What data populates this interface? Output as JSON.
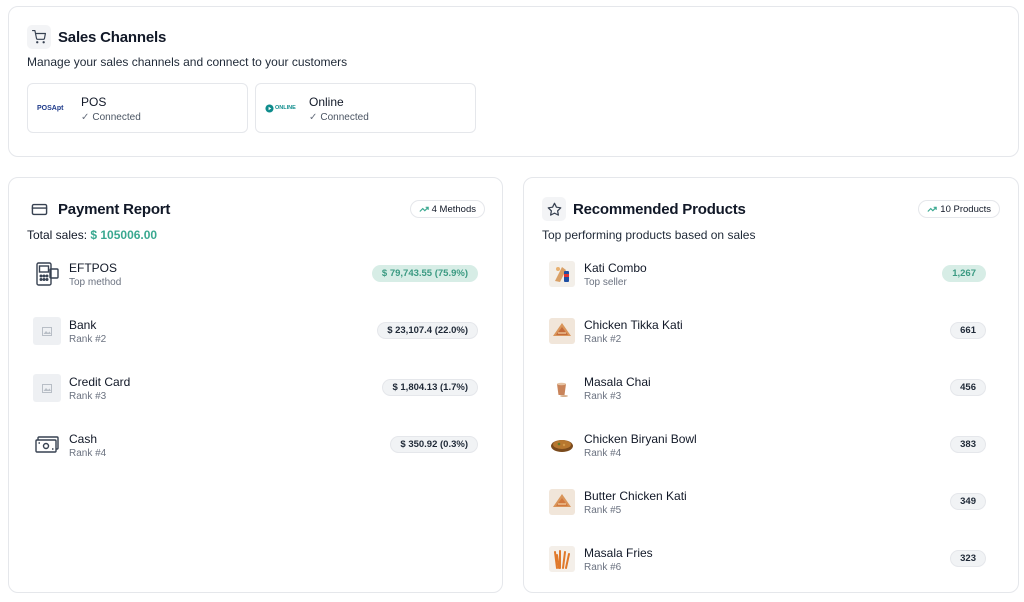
{
  "sales_channels": {
    "title": "Sales Channels",
    "subtitle": "Manage your sales channels and connect to your customers",
    "channels": [
      {
        "name": "POS",
        "status": "Connected",
        "logo": "POSApt"
      },
      {
        "name": "Online",
        "status": "Connected",
        "logo": "ONLINE"
      }
    ]
  },
  "payment_report": {
    "title": "Payment Report",
    "badge": "4 Methods",
    "total_label": "Total sales:",
    "total_value": "$ 105006.00",
    "items": [
      {
        "name": "EFTPOS",
        "meta": "Top method",
        "value": "$ 79,743.55 (75.9%)"
      },
      {
        "name": "Bank",
        "meta": "Rank #2",
        "value": "$ 23,107.4 (22.0%)"
      },
      {
        "name": "Credit Card",
        "meta": "Rank #3",
        "value": "$ 1,804.13 (1.7%)"
      },
      {
        "name": "Cash",
        "meta": "Rank #4",
        "value": "$ 350.92 (0.3%)"
      }
    ]
  },
  "recommended_products": {
    "title": "Recommended Products",
    "badge": "10 Products",
    "subtitle": "Top performing products based on sales",
    "items": [
      {
        "name": "Kati Combo",
        "meta": "Top seller",
        "value": "1,267"
      },
      {
        "name": "Chicken Tikka Kati",
        "meta": "Rank #2",
        "value": "661"
      },
      {
        "name": "Masala Chai",
        "meta": "Rank #3",
        "value": "456"
      },
      {
        "name": "Chicken Biryani Bowl",
        "meta": "Rank #4",
        "value": "383"
      },
      {
        "name": "Butter Chicken Kati",
        "meta": "Rank #5",
        "value": "349"
      },
      {
        "name": "Masala Fries",
        "meta": "Rank #6",
        "value": "323"
      }
    ]
  },
  "colors": {
    "accent": "#3aa890",
    "top_badge_bg": "#d7ede6",
    "border": "#e5e7eb"
  }
}
